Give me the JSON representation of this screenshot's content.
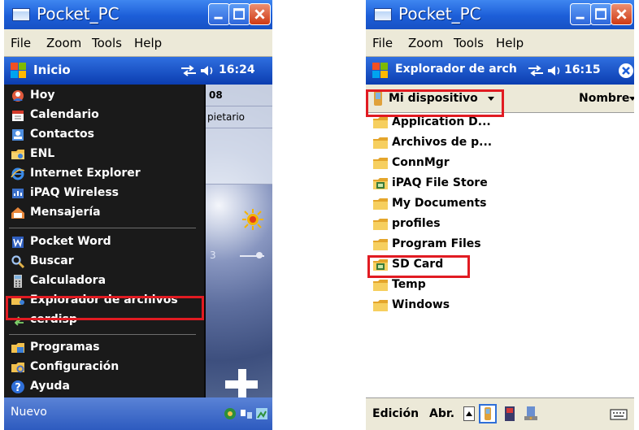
{
  "left_window": {
    "title": "Pocket_PC",
    "menu": [
      "File",
      "Zoom",
      "Tools",
      "Help"
    ],
    "pocket_title": "Inicio",
    "time": "16:24",
    "today_date_fragment": "08",
    "today_owner_fragment": "pietario",
    "temperature_fragment": "3",
    "start_menu": {
      "items": [
        {
          "label": "Hoy",
          "icon": "today-icon"
        },
        {
          "label": "Calendario",
          "icon": "calendar-icon"
        },
        {
          "label": "Contactos",
          "icon": "contacts-icon"
        },
        {
          "label": "ENL",
          "icon": "folder-icon"
        },
        {
          "label": "Internet Explorer",
          "icon": "internet-explorer-icon"
        },
        {
          "label": "iPAQ Wireless",
          "icon": "wireless-icon"
        },
        {
          "label": "Mensajería",
          "icon": "messaging-icon"
        },
        {
          "label": "Pocket Word",
          "icon": "word-icon"
        },
        {
          "label": "Buscar",
          "icon": "search-icon"
        },
        {
          "label": "Calculadora",
          "icon": "calculator-icon"
        },
        {
          "label": "Explorador de archivos",
          "icon": "file-explorer-icon"
        },
        {
          "label": "cerdisp",
          "icon": "cerdisp-icon"
        },
        {
          "label": "Programas",
          "icon": "programs-folder-icon"
        },
        {
          "label": "Configuración",
          "icon": "settings-icon"
        },
        {
          "label": "Ayuda",
          "icon": "help-icon"
        }
      ],
      "highlighted": "Explorador de archivos"
    },
    "bottom_left": "Nuevo"
  },
  "right_window": {
    "title": "Pocket_PC",
    "menu": [
      "File",
      "Zoom",
      "Tools",
      "Help"
    ],
    "pocket_title": "Explorador de arch",
    "time": "16:15",
    "location_dropdown": "Mi dispositivo",
    "sort_dropdown": "Nombre",
    "files": [
      {
        "name": "Application D...",
        "icon": "folder-icon"
      },
      {
        "name": "Archivos de p...",
        "icon": "folder-icon"
      },
      {
        "name": "ConnMgr",
        "icon": "folder-icon"
      },
      {
        "name": "iPAQ File Store",
        "icon": "storage-card-icon"
      },
      {
        "name": "My Documents",
        "icon": "folder-icon"
      },
      {
        "name": "profiles",
        "icon": "folder-icon"
      },
      {
        "name": "Program Files",
        "icon": "folder-icon"
      },
      {
        "name": "SD Card",
        "icon": "storage-card-icon"
      },
      {
        "name": "Temp",
        "icon": "folder-icon"
      },
      {
        "name": "Windows",
        "icon": "folder-icon"
      }
    ],
    "highlighted": "SD Card",
    "bottom_bar": {
      "edit": "Edición",
      "open": "Abr."
    }
  },
  "colors": {
    "highlight_box": "#e11b22",
    "title_bar": "#1c5ed8",
    "close_button": "#d9542b",
    "start_menu_bg": "#1a1a1a"
  }
}
